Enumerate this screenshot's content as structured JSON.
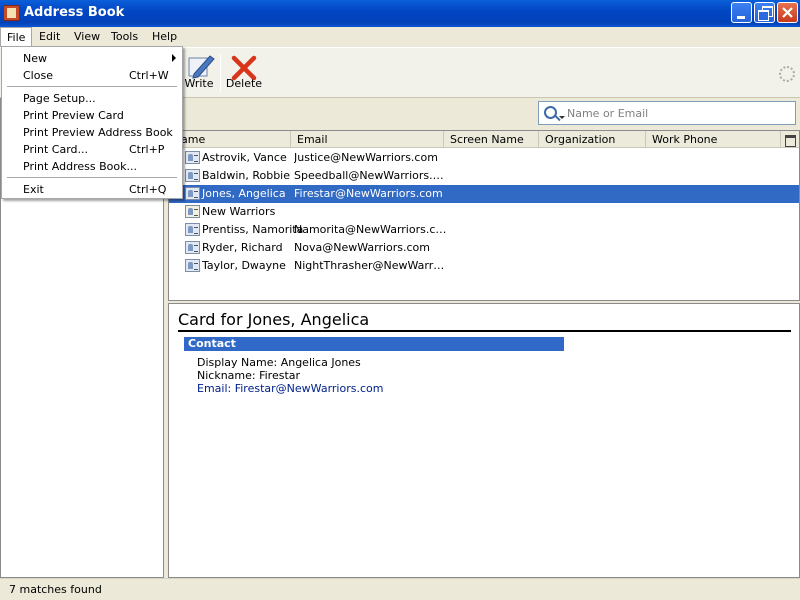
{
  "window": {
    "title": "Address Book"
  },
  "menubar": {
    "items": [
      "File",
      "Edit",
      "View",
      "Tools",
      "Help"
    ]
  },
  "file_menu": {
    "items": [
      {
        "label": "New",
        "accel": "",
        "submenu": true
      },
      {
        "label": "Close",
        "accel": "Ctrl+W"
      },
      {
        "label": "Page Setup...",
        "accel": ""
      },
      {
        "label": "Print Preview Card",
        "accel": ""
      },
      {
        "label": "Print Preview Address Book",
        "accel": ""
      },
      {
        "label": "Print Card...",
        "accel": "Ctrl+P"
      },
      {
        "label": "Print Address Book...",
        "accel": ""
      },
      {
        "label": "Exit",
        "accel": "Ctrl+Q"
      }
    ]
  },
  "toolbar": {
    "write_label": "Write",
    "delete_label": "Delete"
  },
  "search": {
    "placeholder": "Name or Email"
  },
  "columns": [
    "ame",
    "Email",
    "Screen Name",
    "Organization",
    "Work Phone"
  ],
  "contacts": [
    {
      "name": "Astrovik, Vance",
      "email": "Justice@NewWarriors.com",
      "type": "card",
      "selected": false
    },
    {
      "name": "Baldwin, Robbie",
      "email": "Speedball@NewWarriors.com",
      "type": "card",
      "selected": false
    },
    {
      "name": "Jones, Angelica",
      "email": "Firestar@NewWarriors.com",
      "type": "card",
      "selected": true
    },
    {
      "name": "New Warriors",
      "email": "",
      "type": "list",
      "selected": false
    },
    {
      "name": "Prentiss, Namorita",
      "email": "Namorita@NewWarriors.com",
      "type": "card",
      "selected": false
    },
    {
      "name": "Ryder, Richard",
      "email": "Nova@NewWarriors.com",
      "type": "card",
      "selected": false
    },
    {
      "name": "Taylor, Dwayne",
      "email": "NightThrasher@NewWarriors.com",
      "type": "card",
      "selected": false
    }
  ],
  "card": {
    "title": "Card for Jones, Angelica",
    "section": "Contact",
    "display_name": "Display Name: Angelica Jones",
    "nickname": "Nickname: Firestar",
    "email": "Email: Firestar@NewWarriors.com"
  },
  "status": {
    "text": "7 matches found"
  },
  "colors": {
    "selection": "#316ac5",
    "section_header": "#3069c8",
    "link": "#00208a",
    "delete_icon": "#d8351b",
    "titlebar": "#0346c4"
  },
  "icons": [
    "app-icon",
    "write-icon",
    "delete-icon",
    "search-icon",
    "column-picker-icon",
    "contact-card-icon",
    "mailing-list-icon",
    "throbber-icon"
  ]
}
